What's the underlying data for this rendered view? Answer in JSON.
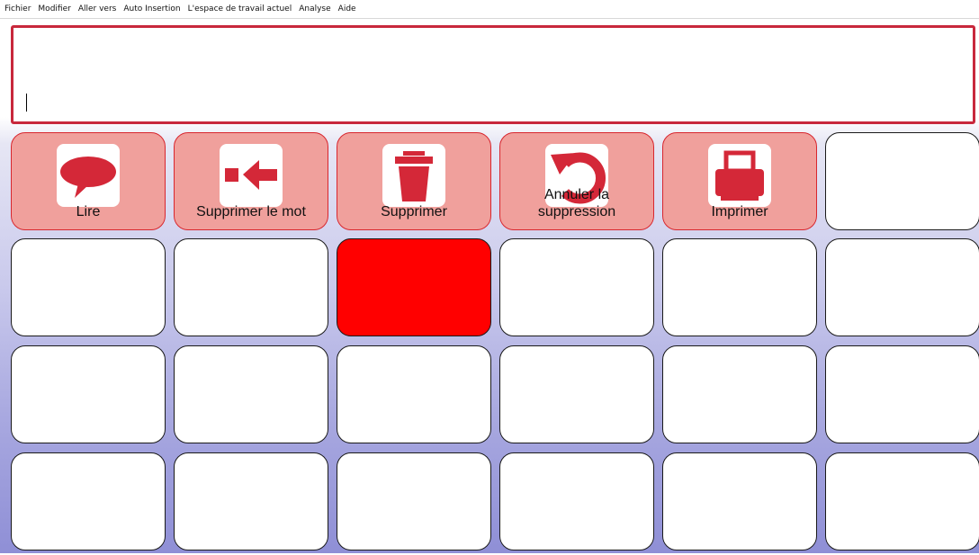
{
  "menu": {
    "items": [
      "Fichier",
      "Modifier",
      "Aller vers",
      "Auto Insertion",
      "L'espace de travail actuel",
      "Analyse",
      "Aide"
    ]
  },
  "message_window": {
    "text": ""
  },
  "toolbar": {
    "buttons": [
      {
        "label": "Lire",
        "icon": "speech-bubble-icon"
      },
      {
        "label": "Supprimer le mot",
        "icon": "delete-word-arrow-icon"
      },
      {
        "label": "Supprimer",
        "icon": "trash-can-icon"
      },
      {
        "label_line1": "Annuler la",
        "label_line2": "suppression",
        "icon": "undo-icon"
      },
      {
        "label": "Imprimer",
        "icon": "printer-icon"
      }
    ]
  },
  "colors": {
    "accent": "#c8283c",
    "action_cell_bg": "#f0a09c",
    "selected_cell_bg": "#ff0000",
    "icon_red": "#d42838"
  }
}
